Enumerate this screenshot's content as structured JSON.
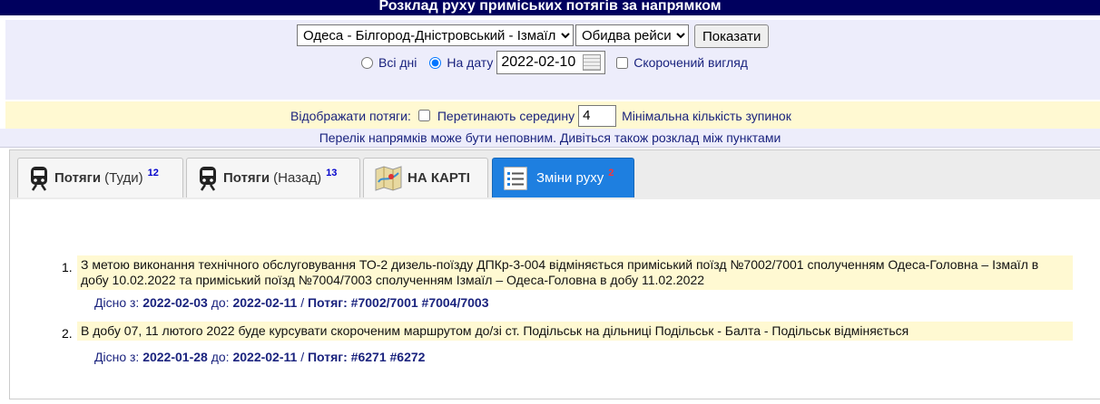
{
  "header": {
    "title": "Розклад руху приміських потягів за напрямком"
  },
  "filters": {
    "direction_selected": "Одеса - Білгород-Дністровський - Ізмаїл",
    "trips_selected": "Обидва рейси",
    "show_button": "Показати",
    "all_days_label": "Всі дні",
    "on_date_label": "На дату",
    "date_value": "2022-02-10",
    "short_view_label": "Скорочений вигляд"
  },
  "display": {
    "label": "Відображати потяги:",
    "cross_middle_label": "Перетинають середину",
    "min_stops_value": "4",
    "min_stops_label": "Мінімальна кількість зупинок"
  },
  "note": {
    "text": "Перелік напрямків може бути неповним. Дивіться також розклад між пунктами"
  },
  "tabs": [
    {
      "bold": "Потяги",
      "extra": "(Туди)",
      "count": "12"
    },
    {
      "bold": "Потяги",
      "extra": "(Назад)",
      "count": "13"
    },
    {
      "bold": "НА КАРТІ"
    },
    {
      "label": "Зміни руху",
      "count": "2"
    }
  ],
  "notices": [
    {
      "num": "1.",
      "text": "З метою виконання технічного обслуговування ТО-2 дизель-поїзду ДПКр-3-004 відміняється приміський поїзд №7002/7001 сполученням Одеса-Головна – Ізмаїл в добу 10.02.2022 та приміський поїзд №7004/7003 сполученням Ізмаїл – Одеса-Головна в добу 11.02.2022",
      "valid_label": "Дісно з:",
      "from": "2022-02-03",
      "to_label": "до:",
      "to": "2022-02-11",
      "train_label": "Потяг:",
      "trains": "#7002/7001 #7004/7003"
    },
    {
      "num": "2.",
      "text": "В добу 07, 11 лютого 2022 буде курсувати скороченим маршрутом до/зі ст. Подільськ на дільниці Подільськ - Балта - Подільськ відміняється",
      "valid_label": "Дісно з:",
      "from": "2022-01-28",
      "to_label": "до:",
      "to": "2022-02-11",
      "train_label": "Потяг:",
      "trains": "#6271 #6272"
    }
  ],
  "colors": {
    "header_bg": "#00005e",
    "active_tab": "#1e7fe0",
    "highlight": "#fff9d2"
  }
}
